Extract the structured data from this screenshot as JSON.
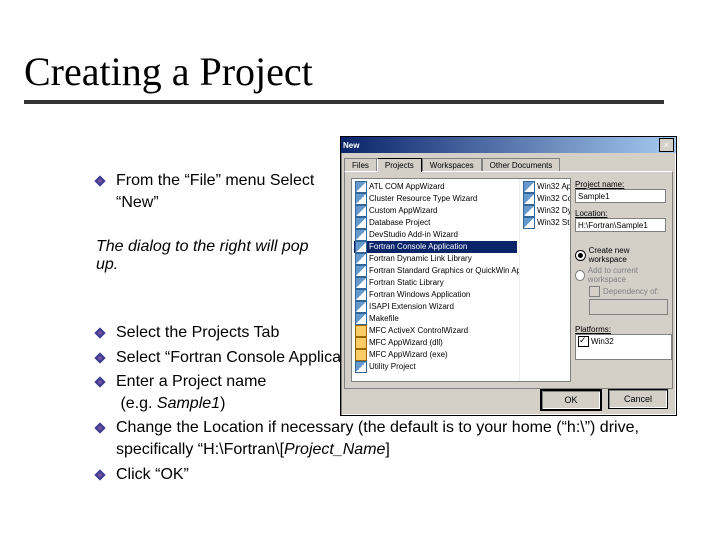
{
  "title": "Creating a Project",
  "bullets_a": [
    "From the “File” menu Select “New”"
  ],
  "note": "The dialog to the right will pop up.",
  "bullets_b": [
    {
      "text": "Select the Projects Tab"
    },
    {
      "text": "Select “Fortran Console Application”"
    },
    {
      "html": "Enter a Project name<br>&nbsp;(e.g. <em>Sample1</em>)"
    },
    {
      "html": "Change the Location if necessary (the default is to your home (“h:\\”) drive, specifically “H:\\Fortran\\[<em>Project_Name</em>]"
    },
    {
      "text": "Click “OK”"
    }
  ],
  "dialog": {
    "title": "New",
    "close_x": "×",
    "tabs": [
      "Files",
      "Projects",
      "Workspaces",
      "Other Documents"
    ],
    "active_tab": 1,
    "list_col1": [
      "ATL COM AppWizard",
      "Cluster Resource Type Wizard",
      "Custom AppWizard",
      "Database Project",
      "DevStudio Add-in Wizard",
      "Fortran Console Application",
      "Fortran Dynamic Link Library",
      "Fortran Standard Graphics or QuickWin Application",
      "Fortran Static Library",
      "Fortran Windows Application",
      "ISAPI Extension Wizard",
      "Makefile",
      "MFC ActiveX ControlWizard",
      "MFC AppWizard (dll)",
      "MFC AppWizard (exe)",
      "Utility Project"
    ],
    "list_selected_index": 5,
    "list_col2": [
      "Win32 Ap",
      "Win32 Co",
      "Win32 Dy",
      "Win32 St"
    ],
    "pname_label": "Project name:",
    "pname_value": "Sample1",
    "loc_label": "Location:",
    "loc_value": "H:\\Fortran\\Sample1",
    "radio_new": "Create new workspace",
    "radio_add": "Add to current workspace",
    "chk_dep": "Dependency of:",
    "plat_label": "Platforms:",
    "plat_item": "Win32",
    "btn_ok": "OK",
    "btn_cancel": "Cancel"
  }
}
